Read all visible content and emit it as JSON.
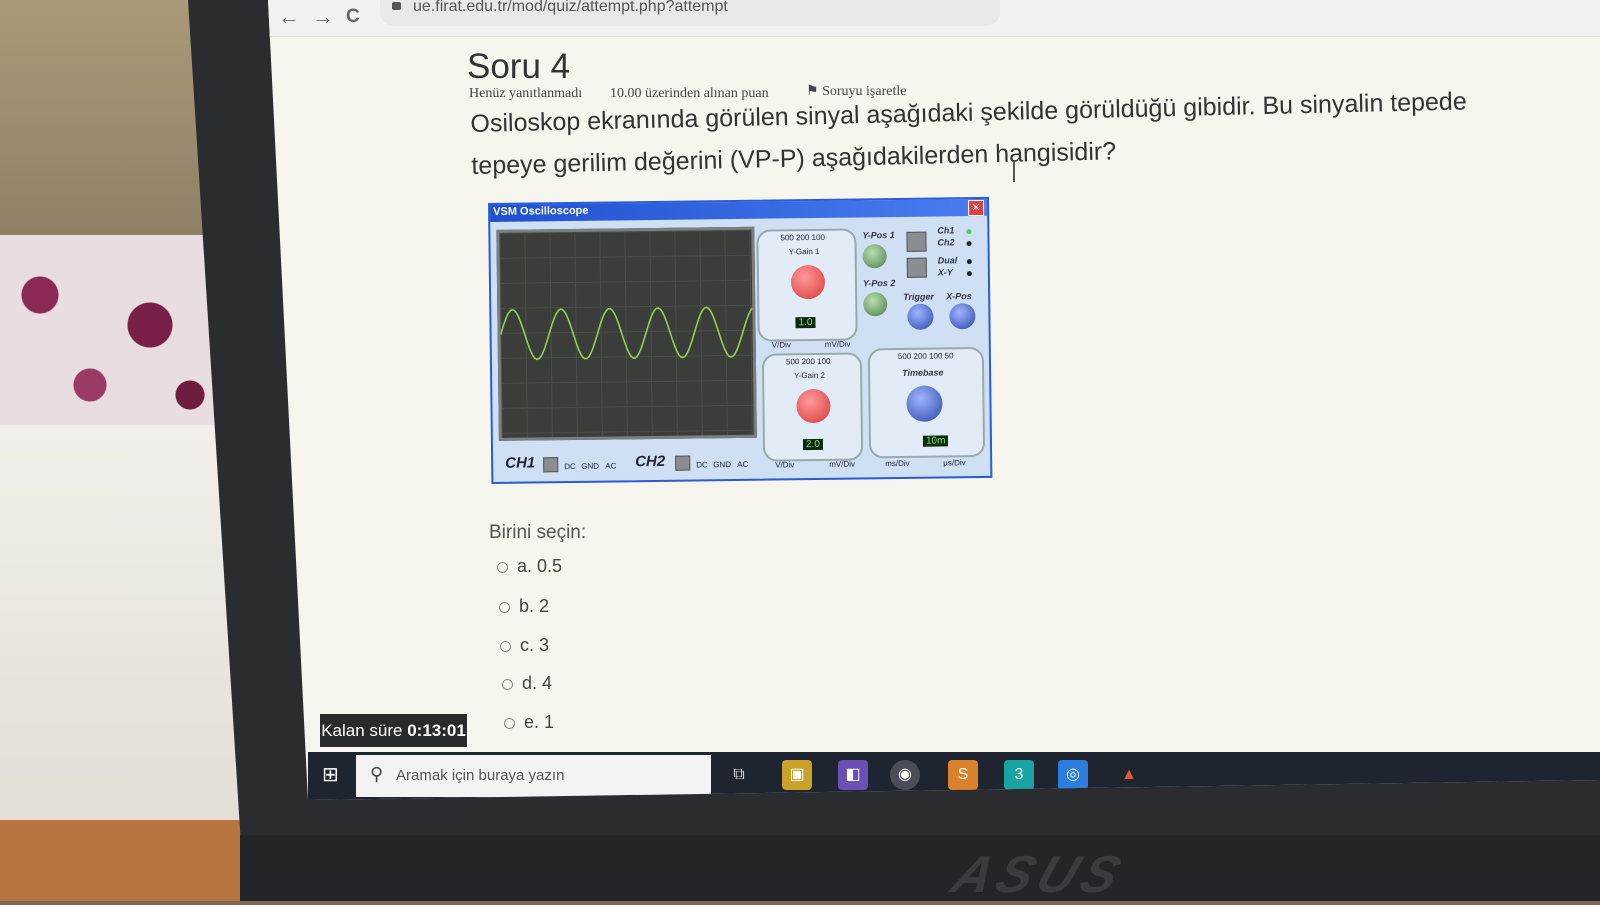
{
  "browser": {
    "url": "ue.firat.edu.tr/mod/quiz/attempt.php?attempt",
    "back_icon": "←",
    "forward_icon": "→",
    "reload_icon": "C"
  },
  "quiz": {
    "title": "Soru 4",
    "status": "Henüz yanıtlanmadı",
    "points": "10.00 üzerinden alınan puan",
    "flag": "Soruyu işaretle",
    "question_line1": "Osiloskop ekranında görülen sinyal aşağıdaki şekilde görüldüğü gibidir. Bu sinyalin tepede",
    "question_line2": "tepeye gerilim değerini (VP-P) aşağıdakilerden hangisidir?",
    "choose_label": "Birini seçin:",
    "options": [
      {
        "label": "a. 0.5"
      },
      {
        "label": "b. 2"
      },
      {
        "label": "c. 3"
      },
      {
        "label": "d. 4"
      },
      {
        "label": "e. 1"
      }
    ],
    "timer_label": "Kalan süre",
    "timer_value": "0:13:01"
  },
  "oscilloscope": {
    "window_title": "VSM Oscilloscope",
    "close_icon": "✕",
    "ch1": "CH1",
    "ch2": "CH2",
    "dc": "DC",
    "gnd": "GND",
    "ac": "AC",
    "ygain1": "Y-Gain 1",
    "ygain2": "Y-Gain 2",
    "ypos1": "Y-Pos 1",
    "ypos2": "Y-Pos 2",
    "ch1_led": "Ch1",
    "ch2_led": "Ch2",
    "dual": "Dual",
    "xy": "X-Y",
    "trigger": "Trigger",
    "xpos": "X-Pos",
    "timebase": "Timebase",
    "ygain1_value": "1.0",
    "ygain2_value": "2.0",
    "timebase_value": "10m",
    "vdiv": "V/Div",
    "mvdiv": "mV/Div",
    "msdiv": "ms/Div",
    "usdiv": "µs/Div",
    "top_scale": "500 200 100",
    "tb_scale": "500 200 100 50"
  },
  "taskbar": {
    "search_placeholder": "Aramak için buraya yazın"
  },
  "laptop_brand": "ASUS"
}
